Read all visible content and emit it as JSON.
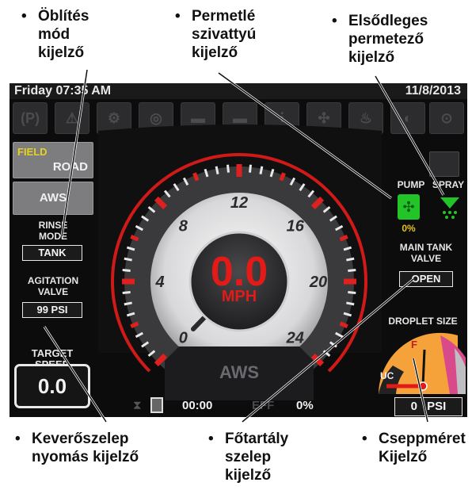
{
  "callouts": {
    "rinse_mode": [
      "Öblítés",
      "mód",
      "kijelző"
    ],
    "pump": [
      "Permetlé",
      "szivattyú",
      "kijelző"
    ],
    "primary_spray": [
      "Elsődleges",
      "permetező",
      "kijelző"
    ],
    "agitation": [
      "Keverőszelep",
      "nyomás kijelző"
    ],
    "main_tank": [
      "Főtartály",
      "szelep",
      "kijelző"
    ],
    "droplet": [
      "Cseppméret",
      "Kijelző"
    ],
    "bullet": "•"
  },
  "header": {
    "day_time": "Friday 07:35 AM",
    "date": "11/8/2013"
  },
  "left_panel": {
    "field_label": "FIELD",
    "road_label": "ROAD",
    "aws_label": "AWS",
    "rinse_mode_label": [
      "RINSE",
      "MODE"
    ],
    "rinse_mode_value": "TANK",
    "agitation_label": [
      "AGITATION",
      "VALVE"
    ],
    "agitation_value": "99 PSI",
    "target_speed_label": "TARGET SPEED",
    "target_speed_value": "0.0"
  },
  "gauge": {
    "speed": "0.0",
    "unit": "MPH",
    "mode": "AWS",
    "tick_labels": [
      "0",
      "4",
      "8",
      "12",
      "16",
      "20",
      "24"
    ],
    "max": 24
  },
  "right_panel": {
    "pump_label": "PUMP",
    "spray_label": "SPRAY",
    "pump_percent": "0%",
    "main_tank_label": [
      "MAIN TANK",
      "VALVE"
    ],
    "main_tank_value": "OPEN",
    "droplet_label": "DROPLET SIZE",
    "droplet_f": "F",
    "droplet_uc": "UC",
    "pressure_value": "0",
    "pressure_unit": "PSI"
  },
  "bottom_bar": {
    "timer": "00:00",
    "eff_label": "EFF",
    "eff_value": "0%"
  },
  "colors": {
    "gauge_red": "#e0201e",
    "pump_green": "#27c22b",
    "droplet_orange": "#f6a23a",
    "background": "#0c0c0d"
  },
  "icons": [
    "park-icon",
    "warning-icon",
    "engine-icon",
    "brake-icon",
    "battery-icon",
    "battery-2-icon",
    "transmission-icon",
    "fan-icon",
    "coolant-icon",
    "hydraulic-icon",
    "service-icon"
  ]
}
